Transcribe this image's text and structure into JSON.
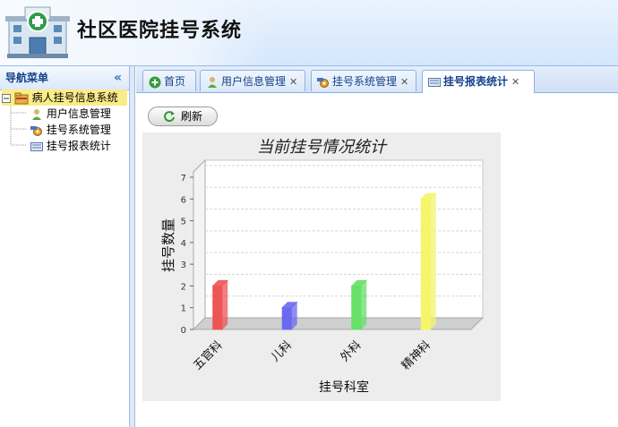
{
  "app": {
    "title": "社区医院挂号系统"
  },
  "nav": {
    "header": "导航菜单",
    "collapse_glyph": "«",
    "root": "病人挂号信息系统",
    "items": [
      "用户信息管理",
      "挂号系统管理",
      "挂号报表统计"
    ]
  },
  "tabs": [
    {
      "label": "首页",
      "icon": "home-icon",
      "closable": false
    },
    {
      "label": "用户信息管理",
      "icon": "user-icon",
      "closable": true
    },
    {
      "label": "挂号系统管理",
      "icon": "settings-icon",
      "closable": true
    },
    {
      "label": "挂号报表统计",
      "icon": "report-icon",
      "closable": true,
      "active": true
    }
  ],
  "toolbar": {
    "refresh_label": "刷新"
  },
  "chart_data": {
    "type": "bar",
    "title": "当前挂号情况统计",
    "xlabel": "挂号科室",
    "ylabel": "挂号数量",
    "categories": [
      "五官科",
      "儿科",
      "外科",
      "精神科"
    ],
    "values": [
      2,
      1,
      2,
      6
    ],
    "colors": [
      "#ee5555",
      "#6a6af0",
      "#66e066",
      "#f5f56a"
    ],
    "ylim": [
      0,
      7
    ],
    "yticks": [
      "0",
      "1",
      "2",
      "3",
      "4",
      "5",
      "6",
      "7"
    ],
    "grid": true,
    "style": "3d"
  }
}
